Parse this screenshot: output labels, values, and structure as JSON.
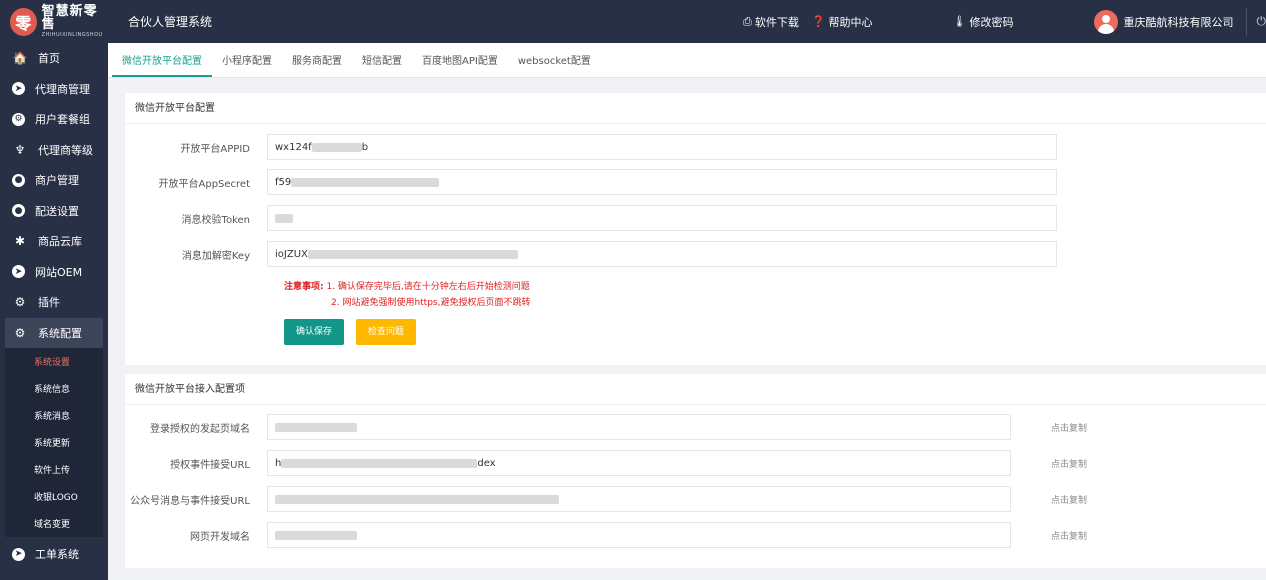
{
  "header": {
    "logo_mark": "零",
    "logo_cn": "智慧新零售",
    "logo_en": "ZHIHUIXINLINGSHOU",
    "system_title": "合伙人管理系统",
    "download_label": "软件下载",
    "help_label": "帮助中心",
    "password_label": "修改密码",
    "company_name": "重庆酷航科技有限公司"
  },
  "sidebar": {
    "items": [
      {
        "label": "首页",
        "icon": "home-icon"
      },
      {
        "label": "代理商管理",
        "icon": "agent-icon"
      },
      {
        "label": "用户套餐组",
        "icon": "package-icon"
      },
      {
        "label": "代理商等级",
        "icon": "level-icon"
      },
      {
        "label": "商户管理",
        "icon": "merchant-icon"
      },
      {
        "label": "配送设置",
        "icon": "delivery-icon"
      },
      {
        "label": "商品云库",
        "icon": "asterisk-icon"
      },
      {
        "label": "网站OEM",
        "icon": "send-icon"
      },
      {
        "label": "插件",
        "icon": "cogs-icon"
      },
      {
        "label": "系统配置",
        "icon": "cogs-icon"
      }
    ],
    "sub_items": [
      "系统设置",
      "系统信息",
      "系统消息",
      "系统更新",
      "软件上传",
      "收银LOGO",
      "域名变更"
    ],
    "bottom_item": {
      "label": "工单系统",
      "icon": "send-icon"
    }
  },
  "tabs": [
    "微信开放平台配置",
    "小程序配置",
    "服务商配置",
    "短信配置",
    "百度地图API配置",
    "websocket配置"
  ],
  "card1": {
    "title": "微信开放平台配置",
    "fields": [
      {
        "label": "开放平台APPID",
        "prefix": "wx124f",
        "suffix": "b"
      },
      {
        "label": "开放平台AppSecret",
        "prefix": "f59",
        "suffix": ""
      },
      {
        "label": "消息校验Token",
        "prefix": "",
        "suffix": ""
      },
      {
        "label": "消息加解密Key",
        "prefix": "ioJZUX",
        "suffix": ""
      }
    ],
    "notice_label": "注意事项:",
    "notice_line1": "1. 确认保存完毕后,请在十分钟左右后开始检测问题",
    "notice_line2": "2. 网站避免强制使用https,避免授权后页面不跳转",
    "save_button": "确认保存",
    "check_button": "检查问题"
  },
  "card2": {
    "title": "微信开放平台接入配置项",
    "copy_label": "点击复制",
    "fields": [
      {
        "label": "登录授权的发起页域名",
        "prefix": "",
        "suffix": ""
      },
      {
        "label": "授权事件接受URL",
        "prefix": "h",
        "suffix": "dex"
      },
      {
        "label": "公众号消息与事件接受URL",
        "prefix": "",
        "suffix": ""
      },
      {
        "label": "网页开发域名",
        "prefix": "",
        "suffix": ""
      }
    ]
  },
  "colors": {
    "header_bg": "#283046",
    "accent_green": "#119688",
    "accent_yellow": "#ffb800",
    "notice_red": "#e02020",
    "active_sub": "#f36f5e"
  }
}
